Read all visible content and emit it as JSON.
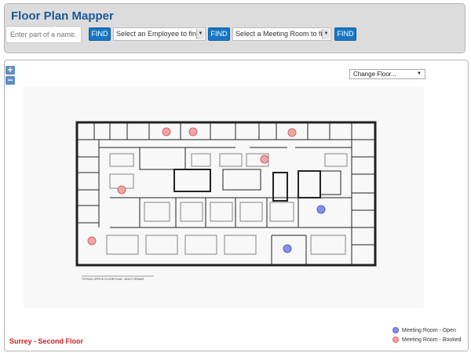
{
  "app": {
    "title": "Floor Plan Mapper"
  },
  "search": {
    "name_placeholder": "Enter part of a name...",
    "find_label_1": "FIND",
    "employee_select": "Select an Employee to find",
    "find_label_2": "FIND",
    "room_select": "Select a Meeting Room to find",
    "find_label_3": "FIND"
  },
  "map": {
    "zoom_in": "+",
    "zoom_out": "−",
    "change_floor": "Change Floor...",
    "plan_caption": "TYPICAL OFFICE FLOOR PLAN - MULTI-TENANT",
    "floor_label": "Surrey - Second Floor",
    "rooms": [
      {
        "status": "booked"
      },
      {
        "status": "booked"
      },
      {
        "status": "booked"
      },
      {
        "status": "booked"
      },
      {
        "status": "booked"
      },
      {
        "status": "booked"
      },
      {
        "status": "open"
      },
      {
        "status": "booked"
      },
      {
        "status": "open"
      }
    ]
  },
  "legend": {
    "open_label": "Meeting Room - Open",
    "booked_label": "Meeting Room - Booked"
  },
  "colors": {
    "title": "#1a5a96",
    "find_button": "#1677c6",
    "open_room": "#8a8ee8",
    "booked_room": "#f2a3a3",
    "floor_label": "#cc2222"
  }
}
